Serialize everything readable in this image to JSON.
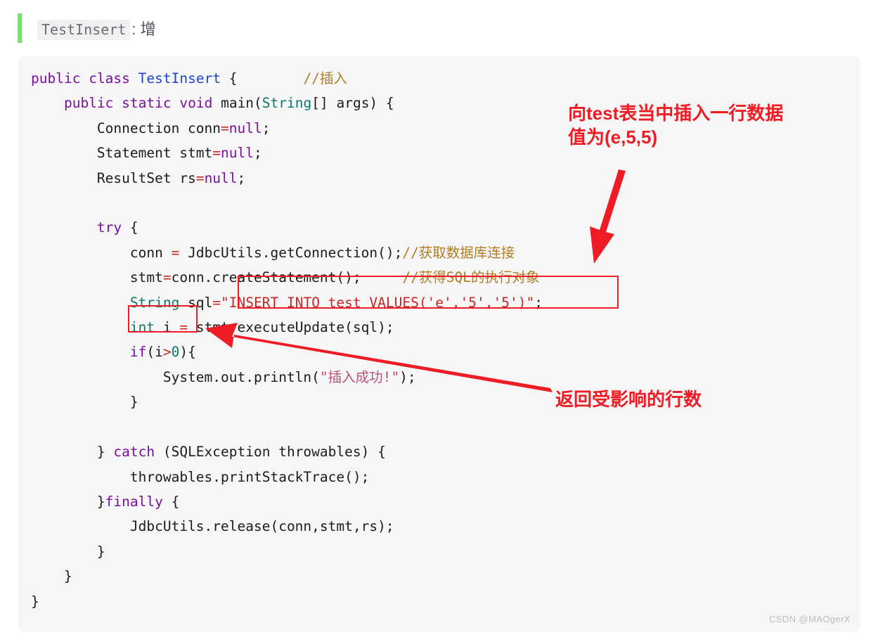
{
  "heading": {
    "badge_label": "TestInsert",
    "rest_label": ": 增"
  },
  "code": {
    "language": "java",
    "listing_plain": "public class TestInsert {        //插入\n    public static void main(String[] args) {\n        Connection conn=null;\n        Statement stmt=null;\n        ResultSet rs=null;\n\n        try {\n            conn = JdbcUtils.getConnection();//获取数据库连接\n            stmt=conn.createStatement();     //获得SQL的执行对象\n            String sql=\"INSERT INTO test VALUES('e','5','5')\";\n            int i = stmt.executeUpdate(sql);\n            if(i>0){\n                System.out.println(\"插入成功!\");\n            }\n\n        } catch (SQLException throwables) {\n            throwables.printStackTrace();\n        }finally {\n            JdbcUtils.release(conn,stmt,rs);\n        }\n    }\n}",
    "lines": [
      "public class TestInsert {        //插入",
      "    public static void main(String[] args) {",
      "        Connection conn=null;",
      "        Statement stmt=null;",
      "        ResultSet rs=null;",
      "",
      "        try {",
      "            conn = JdbcUtils.getConnection();//获取数据库连接",
      "            stmt=conn.createStatement();     //获得SQL的执行对象",
      "            String sql=\"INSERT INTO test VALUES('e','5','5')\";",
      "            int i = stmt.executeUpdate(sql);",
      "            if(i>0){",
      "                System.out.println(\"插入成功!\");",
      "            }",
      "",
      "        } catch (SQLException throwables) {",
      "            throwables.printStackTrace();",
      "        }finally {",
      "            JdbcUtils.release(conn,stmt,rs);",
      "        }",
      "    }",
      "}"
    ],
    "sql_statement": "INSERT INTO test VALUES('e','5','5')",
    "comments": [
      "//插入",
      "//获取数据库连接",
      "//获得SQL的执行对象"
    ],
    "output_message": "插入成功!"
  },
  "annotations": {
    "insert_row": "向test表当中插入一行数据\n值为(e,5,5)",
    "affected_rows": "返回受影响的行数",
    "highlight_boxes": [
      {
        "name": "sql-string",
        "target": "String sql=\"INSERT INTO test VALUES('e','5','5')\";"
      },
      {
        "name": "int-i",
        "target": "int i"
      }
    ],
    "color": "#ee1c25"
  },
  "watermark": {
    "text": "CSDN @MAOgerX"
  },
  "colors": {
    "accent_bar": "#6ee46e",
    "code_background": "#f6f6f6",
    "annotation_red": "#ee1c25",
    "keyword_purple": "#7a0f9e",
    "type_blue": "#1f47c4",
    "type_teal": "#0b7a6a",
    "string_red": "#c62828",
    "comment_orange": "#b07d25"
  }
}
